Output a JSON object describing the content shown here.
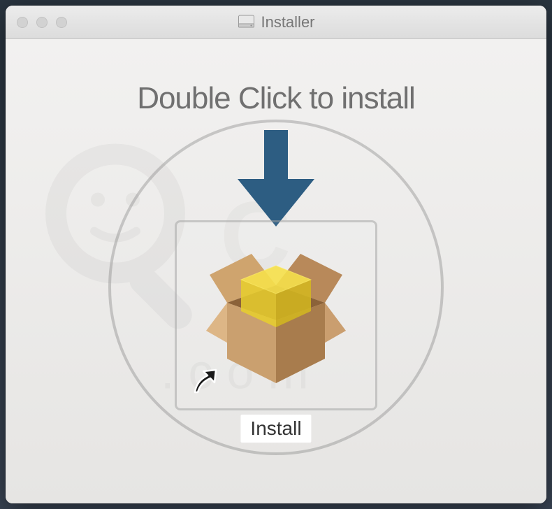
{
  "window": {
    "title": "Installer"
  },
  "content": {
    "instruction": "Double Click to install",
    "icon_label": "Install"
  }
}
